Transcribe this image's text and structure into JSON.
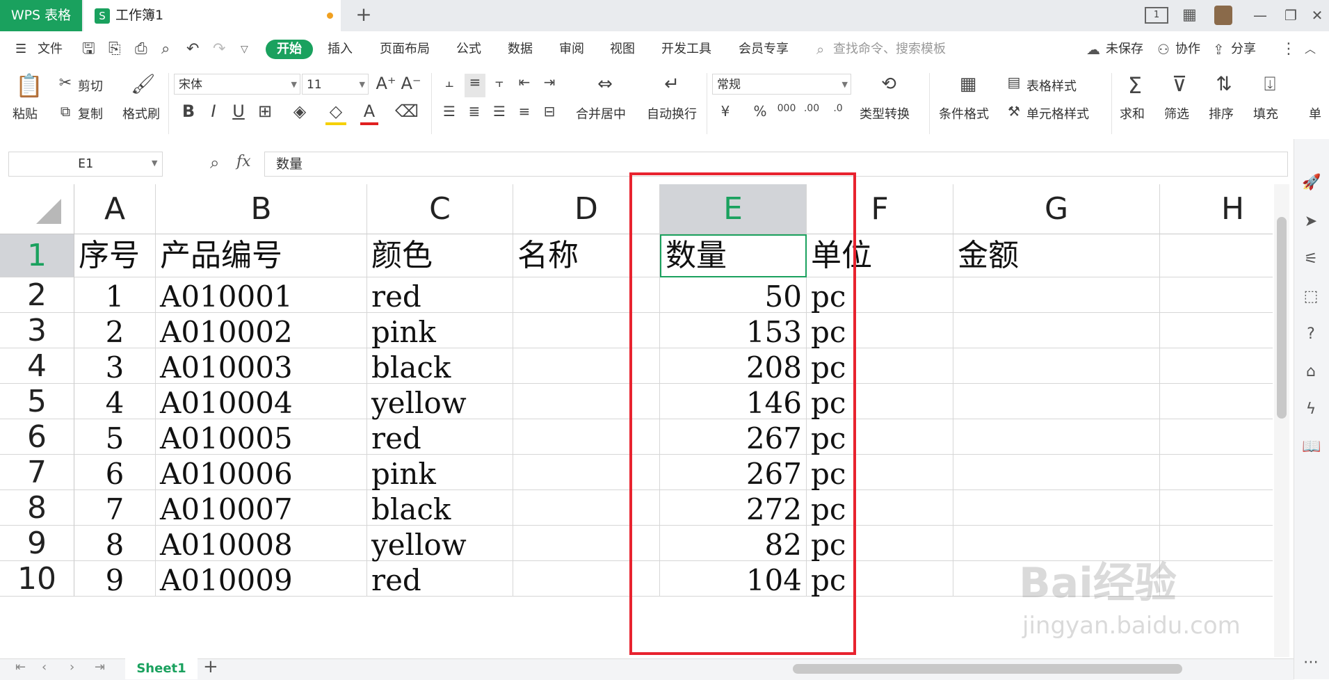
{
  "titlebar": {
    "app_tab": "WPS 表格",
    "doc_tab": "工作簿1",
    "new_tab": "+",
    "window_buttons": [
      "—",
      "❐",
      "✕"
    ]
  },
  "menubar": {
    "file": "文件",
    "start": "开始",
    "items": [
      "插入",
      "页面布局",
      "公式",
      "数据",
      "审阅",
      "视图",
      "开发工具",
      "会员专享"
    ],
    "search_placeholder": "查找命令、搜索模板",
    "unsaved": "未保存",
    "collab": "协作",
    "share": "分享"
  },
  "ribbon": {
    "paste": "粘贴",
    "cut": "剪切",
    "copy": "复制",
    "format_painter": "格式刷",
    "font_name": "宋体",
    "font_size": "11",
    "merge_center": "合并居中",
    "wrap_text": "自动换行",
    "number_format": "常规",
    "type_convert": "类型转换",
    "conditional_format": "条件格式",
    "table_style": "表格样式",
    "cell_style": "单元格样式",
    "sum": "求和",
    "filter": "筛选",
    "sort": "排序",
    "fill": "填充",
    "single": "单",
    "currency": "¥",
    "percent": "%"
  },
  "formula_bar": {
    "name_box": "E1",
    "fx": "fx",
    "value": "数量"
  },
  "grid": {
    "columns": [
      "A",
      "B",
      "C",
      "D",
      "E",
      "F",
      "G",
      "H"
    ],
    "rows": [
      "1",
      "2",
      "3",
      "4",
      "5",
      "6",
      "7",
      "8",
      "9",
      "10"
    ],
    "header_row": [
      "序号",
      "产品编号",
      "颜色",
      "名称",
      "数量",
      "单位",
      "金额",
      ""
    ],
    "data": [
      [
        "1",
        "A010001",
        "red",
        "",
        "50",
        "pc",
        "",
        ""
      ],
      [
        "2",
        "A010002",
        "pink",
        "",
        "153",
        "pc",
        "",
        ""
      ],
      [
        "3",
        "A010003",
        "black",
        "",
        "208",
        "pc",
        "",
        ""
      ],
      [
        "4",
        "A010004",
        "yellow",
        "",
        "146",
        "pc",
        "",
        ""
      ],
      [
        "5",
        "A010005",
        "red",
        "",
        "267",
        "pc",
        "",
        ""
      ],
      [
        "6",
        "A010006",
        "pink",
        "",
        "267",
        "pc",
        "",
        ""
      ],
      [
        "7",
        "A010007",
        "black",
        "",
        "272",
        "pc",
        "",
        ""
      ],
      [
        "8",
        "A010008",
        "yellow",
        "",
        "82",
        "pc",
        "",
        ""
      ],
      [
        "9",
        "A010009",
        "red",
        "",
        "104",
        "pc",
        "",
        ""
      ]
    ]
  },
  "sheets": {
    "active": "Sheet1",
    "add": "+"
  },
  "watermark": {
    "brand": "Bai经验",
    "url": "jingyan.baidu.com"
  },
  "colors": {
    "accent": "#1aa15e",
    "highlight": "#e8232f"
  }
}
